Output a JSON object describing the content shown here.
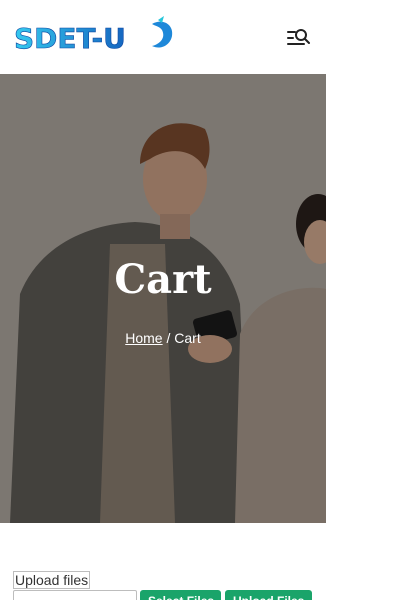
{
  "header": {
    "logo_text": "SDET-U",
    "menu_icon": "menu-search-icon"
  },
  "hero": {
    "title": "Cart",
    "breadcrumb_home": "Home",
    "breadcrumb_separator": " / ",
    "breadcrumb_current": "Cart"
  },
  "upload": {
    "label": "Upload files",
    "select_button": "Select Files",
    "upload_button": "Upload Files"
  },
  "colors": {
    "logo_blue": "#1e88d9",
    "logo_cyan": "#26c6da",
    "button_green": "#1aa46a"
  }
}
